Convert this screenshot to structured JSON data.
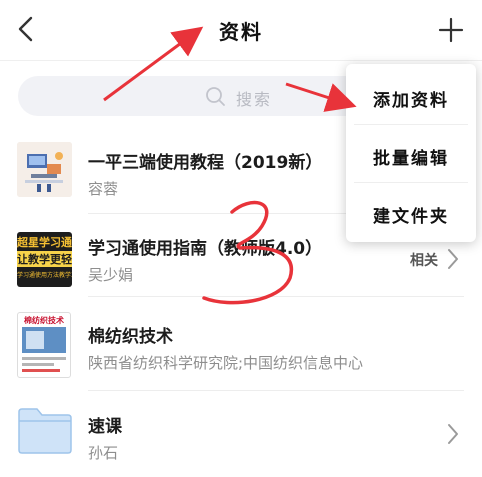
{
  "header": {
    "title": "资料",
    "back_icon": "chevron-left-icon",
    "add_icon": "plus-icon"
  },
  "search": {
    "placeholder": "搜索",
    "icon": "search-icon"
  },
  "list": [
    {
      "title": "一平三端使用教程（2019新）",
      "subtitle": "容蓉",
      "thumb_icon": "tutorial-thumbnail"
    },
    {
      "title": "学习通使用指南（教师版4.0）",
      "subtitle": "吴少娟",
      "thumb_icon": "guide-thumbnail",
      "thumb_text_top": "超星学习通",
      "thumb_text_mid": "让教学更轻松",
      "thumb_text_bottom": "学习通使用方法教学工具",
      "action": "相关"
    },
    {
      "title": "棉纺织技术",
      "subtitle": "陕西省纺织科学研究院;中国纺织信息中心",
      "thumb_icon": "journal-cover-thumbnail",
      "thumb_text_top": "棉纺织技术"
    },
    {
      "title": "速课",
      "subtitle": "孙石",
      "thumb_icon": "folder-icon"
    }
  ],
  "menu": {
    "items": [
      "添加资料",
      "批量编辑",
      "建文件夹"
    ]
  },
  "annotations": {
    "handwritten_number": "3",
    "arrow_color": "#e8333a"
  },
  "colors": {
    "accent_red": "#e8333a",
    "folder_blue": "#bcd8f5",
    "search_bg": "#f1f2f6"
  }
}
